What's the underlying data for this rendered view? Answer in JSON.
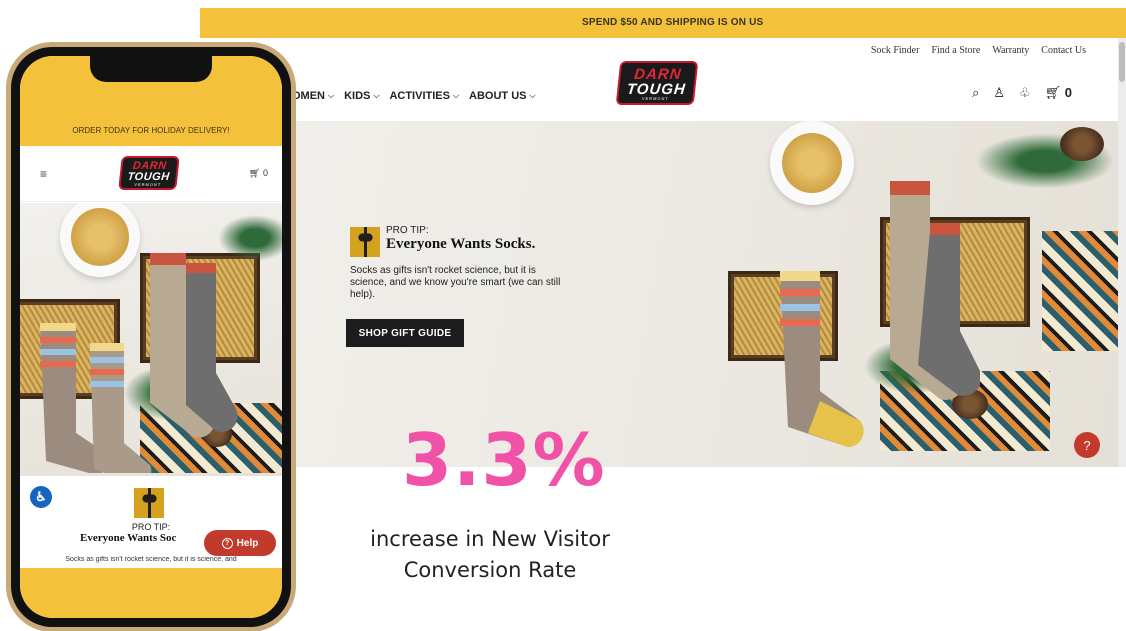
{
  "desktop": {
    "promo": "SPEND $50 AND SHIPPING IS ON US",
    "utility_links": [
      "Sock Finder",
      "Find a Store",
      "Warranty",
      "Contact Us"
    ],
    "nav_items": [
      "OMEN",
      "KIDS",
      "ACTIVITIES",
      "ABOUT US"
    ],
    "logo": {
      "line1": "DARN",
      "line2": "TOUGH",
      "line3": "VERMONT"
    },
    "cart_count": "0",
    "hero": {
      "tip_label": "PRO TIP:",
      "tip_heading": "Everyone Wants Socks.",
      "tip_body": "Socks as gifts isn't rocket science, but it is science, and we know you're smart (we can still help).",
      "cta": "SHOP GIFT GUIDE"
    },
    "help_icon": "?"
  },
  "mobile": {
    "promo": "ORDER TODAY FOR HOLIDAY DELIVERY!",
    "logo": {
      "line1": "DARN",
      "line2": "TOUGH",
      "line3": "VERMONT"
    },
    "cart_count": "0",
    "tip_label": "PRO TIP:",
    "tip_heading": "Everyone Wants Soc",
    "tip_body": "Socks as gifts isn't rocket science, but it is science, and",
    "help_label": "Help",
    "help_icon": "?"
  },
  "stat": {
    "value": "3.3%",
    "caption": "increase in New Visitor Conversion Rate"
  },
  "colors": {
    "brand_yellow": "#f4c13a",
    "stat_pink": "#f052a8",
    "help_red": "#c23a2b"
  }
}
